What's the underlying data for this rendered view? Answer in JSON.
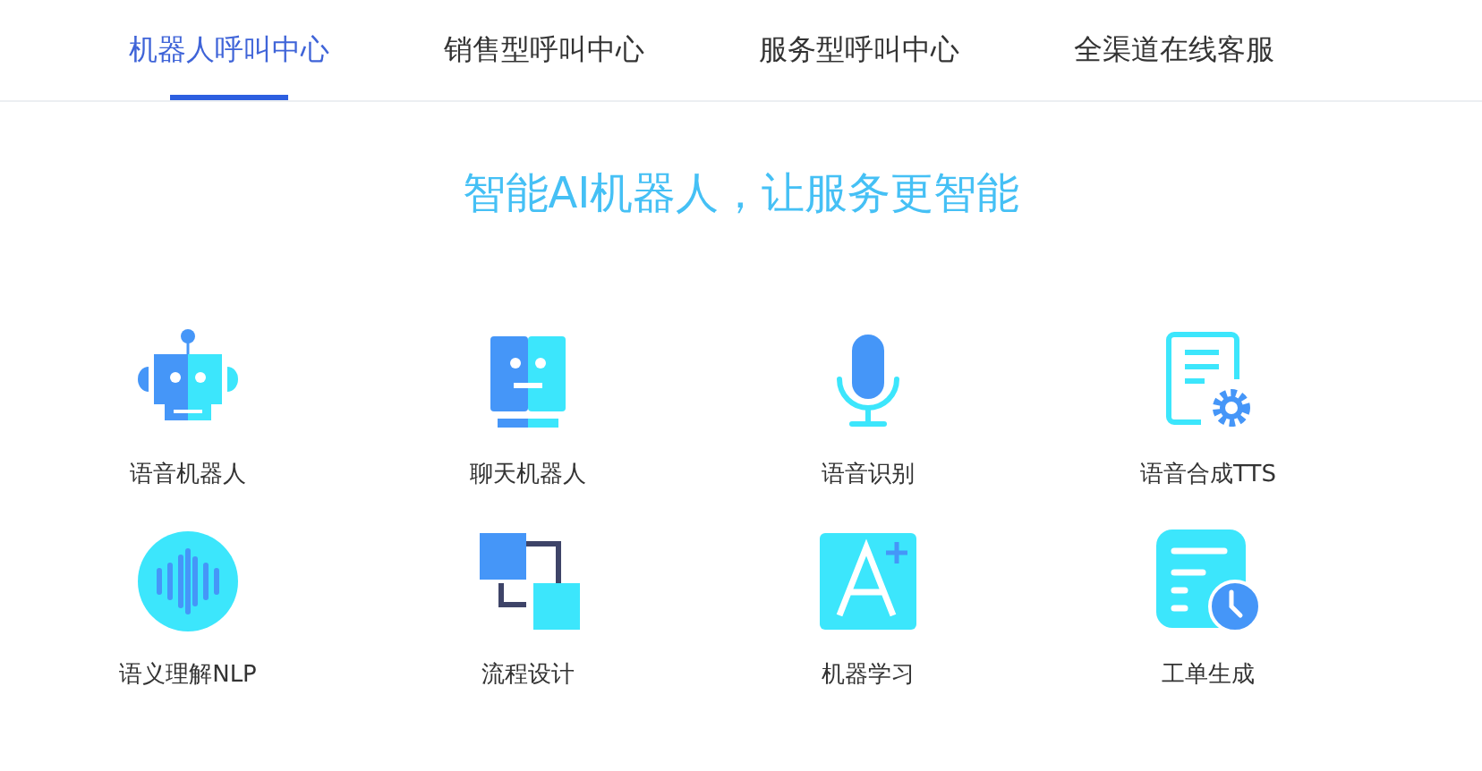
{
  "tabs": [
    {
      "label": "机器人呼叫中心",
      "selected": true
    },
    {
      "label": "销售型呼叫中心",
      "selected": false
    },
    {
      "label": "服务型呼叫中心",
      "selected": false
    },
    {
      "label": "全渠道在线客服",
      "selected": false
    }
  ],
  "headline": "智能AI机器人，让服务更智能",
  "features": [
    {
      "label": "语音机器人"
    },
    {
      "label": "聊天机器人"
    },
    {
      "label": "语音识别"
    },
    {
      "label": "语音合成TTS"
    },
    {
      "label": "语义理解NLP"
    },
    {
      "label": "流程设计"
    },
    {
      "label": "机器学习"
    },
    {
      "label": "工单生成"
    }
  ]
}
